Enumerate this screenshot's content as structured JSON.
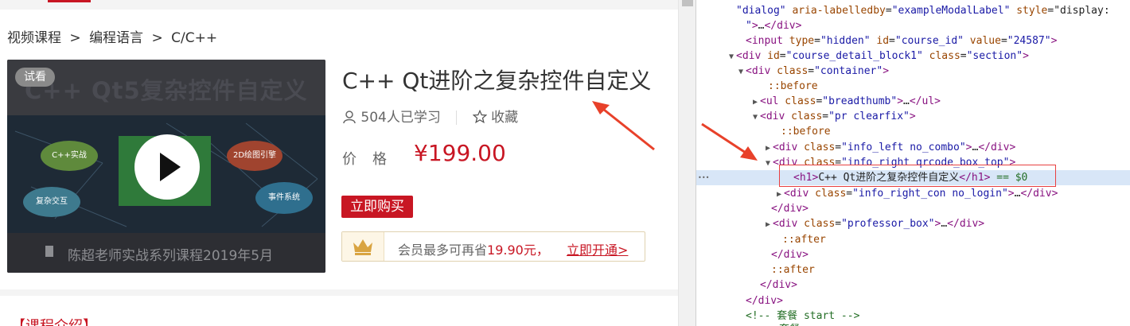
{
  "breadcrumb": [
    "视频课程",
    ">",
    "编程语言",
    ">",
    "C/C++"
  ],
  "thumbnail": {
    "badge": "试看",
    "title": "C++ Qt5复杂控件自定义",
    "bottom_text": "陈超老师实战系列课程2019年5月",
    "bubbles": [
      "C++实战",
      "2D绘图引擎",
      "复杂交互",
      "事件系统"
    ]
  },
  "course": {
    "title": "C++ Qt进阶之复杂控件自定义",
    "learners": "504人已学习",
    "favorite": "收藏",
    "price_label": "价格",
    "price": "¥199.00",
    "buy_label": "立即购买",
    "vip_text_prefix": "会员最多可再省",
    "vip_amount": "19.90元，",
    "vip_link": "立即开通>"
  },
  "intro_heading": "【课程介绍】",
  "devtools": {
    "lines": [
      {
        "indent": 0,
        "tri": "",
        "parts": [
          [
            "val",
            "\"dialog\""
          ],
          [
            "attr",
            " aria-labelledby"
          ],
          [
            "txt",
            "="
          ],
          [
            "val",
            "\"exampleModalLabel\""
          ],
          [
            "attr",
            " style"
          ],
          [
            "txt",
            "=\"display:"
          ]
        ]
      },
      {
        "indent": 0,
        "tri": "",
        "parts": [
          [
            "val",
            "\""
          ],
          [
            "tag",
            ">"
          ],
          [
            "txt",
            "…"
          ],
          [
            "tag",
            "</div>"
          ]
        ]
      },
      {
        "indent": 1,
        "tri": "",
        "parts": [
          [
            "tag",
            "<input"
          ],
          [
            "attr",
            " type"
          ],
          [
            "txt",
            "="
          ],
          [
            "val",
            "\"hidden\""
          ],
          [
            "attr",
            " id"
          ],
          [
            "txt",
            "="
          ],
          [
            "val",
            "\"course_id\""
          ],
          [
            "attr",
            " value"
          ],
          [
            "txt",
            "="
          ],
          [
            "val",
            "\"24587\""
          ],
          [
            "tag",
            ">"
          ]
        ]
      },
      {
        "indent": 0,
        "tri": "▼",
        "parts": [
          [
            "tag",
            "<div"
          ],
          [
            "attr",
            " id"
          ],
          [
            "txt",
            "="
          ],
          [
            "val",
            "\"course_detail_block1\""
          ],
          [
            "attr",
            " class"
          ],
          [
            "txt",
            "="
          ],
          [
            "val",
            "\"section\""
          ],
          [
            "tag",
            ">"
          ]
        ]
      },
      {
        "indent": 1,
        "tri": "▼",
        "parts": [
          [
            "tag",
            "<div"
          ],
          [
            "attr",
            " class"
          ],
          [
            "txt",
            "="
          ],
          [
            "val",
            "\"container\""
          ],
          [
            "tag",
            ">"
          ]
        ]
      },
      {
        "indent": 3,
        "tri": "",
        "parts": [
          [
            "pseudo",
            "::before"
          ]
        ]
      },
      {
        "indent": 2,
        "tri": "▶",
        "parts": [
          [
            "tag",
            "<ul"
          ],
          [
            "attr",
            " class"
          ],
          [
            "txt",
            "="
          ],
          [
            "val",
            "\"breadthumb\""
          ],
          [
            "tag",
            ">"
          ],
          [
            "txt",
            "…"
          ],
          [
            "tag",
            "</ul>"
          ]
        ]
      },
      {
        "indent": 2,
        "tri": "▼",
        "parts": [
          [
            "tag",
            "<div"
          ],
          [
            "attr",
            " class"
          ],
          [
            "txt",
            "="
          ],
          [
            "val",
            "\"pr clearfix\""
          ],
          [
            "tag",
            ">"
          ]
        ]
      },
      {
        "indent": 4,
        "tri": "",
        "parts": [
          [
            "pseudo",
            "::before"
          ]
        ]
      },
      {
        "indent": 3,
        "tri": "▶",
        "parts": [
          [
            "tag",
            "<div"
          ],
          [
            "attr",
            " class"
          ],
          [
            "txt",
            "="
          ],
          [
            "val",
            "\"info_left no_combo\""
          ],
          [
            "tag",
            ">"
          ],
          [
            "txt",
            "…"
          ],
          [
            "tag",
            "</div>"
          ]
        ]
      },
      {
        "indent": 3,
        "tri": "▼",
        "parts": [
          [
            "tag",
            "<div"
          ],
          [
            "attr",
            " class"
          ],
          [
            "txt",
            "="
          ],
          [
            "val",
            "\"info_right qrcode_box_top\""
          ],
          [
            "tag",
            ">"
          ]
        ]
      },
      {
        "indent": 5,
        "tri": "",
        "parts": [
          [
            "tag",
            "<h1>"
          ],
          [
            "txt",
            "C++ Qt进阶之复杂控件自定义"
          ],
          [
            "tag",
            "</h1>"
          ],
          [
            "comment",
            " == $0"
          ]
        ],
        "selected": true
      },
      {
        "indent": 4,
        "tri": "▶",
        "parts": [
          [
            "tag",
            "<div"
          ],
          [
            "attr",
            " class"
          ],
          [
            "txt",
            "="
          ],
          [
            "val",
            "\"info_right_con no_login\""
          ],
          [
            "tag",
            ">"
          ],
          [
            "txt",
            "…"
          ],
          [
            "tag",
            "</div>"
          ]
        ]
      },
      {
        "indent": 4,
        "tri": "",
        "parts": [
          [
            "tag",
            "</div>"
          ]
        ]
      },
      {
        "indent": 3,
        "tri": "▶",
        "parts": [
          [
            "tag",
            "<div"
          ],
          [
            "attr",
            " class"
          ],
          [
            "txt",
            "="
          ],
          [
            "val",
            "\"professor_box\""
          ],
          [
            "tag",
            ">"
          ],
          [
            "txt",
            "…"
          ],
          [
            "tag",
            "</div>"
          ]
        ]
      },
      {
        "indent": 4,
        "tri": "",
        "parts": [
          [
            "pseudo",
            "::after"
          ]
        ]
      },
      {
        "indent": 3,
        "tri": "",
        "parts": [
          [
            "tag",
            "</div>"
          ]
        ]
      },
      {
        "indent": 2,
        "tri": "",
        "parts": [
          [
            "pseudo",
            "::after"
          ]
        ]
      },
      {
        "indent": 2,
        "tri": "",
        "parts": [
          [
            "tag",
            "</div>"
          ]
        ]
      },
      {
        "indent": 1,
        "tri": "",
        "parts": [
          [
            "tag",
            "</div>"
          ]
        ]
      },
      {
        "indent": 1,
        "tri": "",
        "parts": [
          [
            "comment",
            "<!-- 套餐 start -->"
          ]
        ]
      },
      {
        "indent": 3,
        "tri": "",
        "parts": [
          [
            "comment",
            "套餐"
          ]
        ]
      }
    ]
  }
}
